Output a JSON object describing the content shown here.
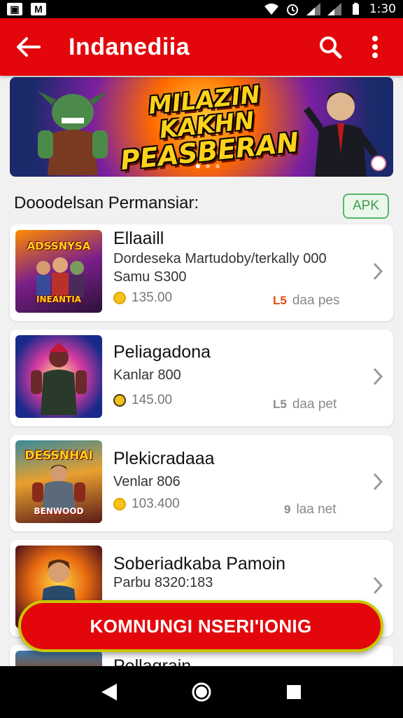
{
  "status_bar": {
    "time": "1:30"
  },
  "app_bar": {
    "title": "Indanediia"
  },
  "banner": {
    "line1": "MILAZIN KAKHN",
    "line2": "PEASBERAN",
    "active_dot": 0
  },
  "section": {
    "title": "Dooodelsan Permansiar:",
    "badge": "APK"
  },
  "items": [
    {
      "title": "Ellaaill",
      "sub1": "Dordeseka Martudoby/terkally 000",
      "sub2": "Samu S300",
      "price": "135.00",
      "meta_icon": "L5",
      "meta": "daa pes",
      "thumb_label": "ADSSNYSA",
      "thumb_label2": "INEANTIA"
    },
    {
      "title": "Peliagadona",
      "sub1": "Kanlar 800",
      "sub2": "",
      "price": "145.00",
      "meta_icon": "L5",
      "meta": "daa pet",
      "thumb_label": "",
      "thumb_label2": ""
    },
    {
      "title": "Plekicradaaa",
      "sub1": "Venlar 806",
      "sub2": "",
      "price": "103.400",
      "meta_icon": "9",
      "meta": "laa net",
      "thumb_label": "DESSNHAI",
      "thumb_label2": "BENWOOD"
    },
    {
      "title": "Soberiadkaba Pamoin",
      "sub1": "Parbu 8320:183",
      "sub2": "",
      "price": "",
      "meta_icon": "",
      "meta": "",
      "thumb_label": "",
      "thumb_label2": ""
    },
    {
      "title": "Pellagrain"
    }
  ],
  "cta": {
    "label": "KOMNUNGI NSERI'IONIG"
  }
}
